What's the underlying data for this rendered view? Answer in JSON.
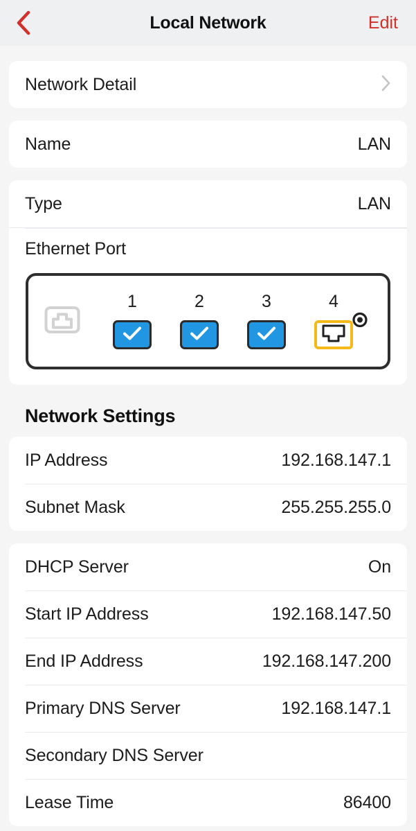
{
  "navbar": {
    "back_icon": "chevron-left-icon",
    "title": "Local Network",
    "edit_label": "Edit",
    "accent_color": "#d0312b"
  },
  "detail_card": {
    "label": "Network Detail",
    "disclosure_icon": "chevron-right-icon"
  },
  "name_card": {
    "label": "Name",
    "value": "LAN"
  },
  "type_card": {
    "type_label": "Type",
    "type_value": "LAN",
    "ethernet_label": "Ethernet Port"
  },
  "ethernet_panel": {
    "device_icon": "ethernet-port-icon",
    "indicator_icon": "led-indicator-icon",
    "ports": [
      {
        "number": "1",
        "state": "checked",
        "icon": "check-icon",
        "color": "#2196e3"
      },
      {
        "number": "2",
        "state": "checked",
        "icon": "check-icon",
        "color": "#2196e3"
      },
      {
        "number": "3",
        "state": "checked",
        "icon": "check-icon",
        "color": "#2196e3"
      },
      {
        "number": "4",
        "state": "wan",
        "icon": "rj45-jack-icon",
        "color": "#f5b919"
      }
    ]
  },
  "network_settings": {
    "title": "Network Settings",
    "rows": [
      {
        "label": "IP Address",
        "value": "192.168.147.1"
      },
      {
        "label": "Subnet Mask",
        "value": "255.255.255.0"
      }
    ]
  },
  "dhcp": {
    "rows": [
      {
        "label": "DHCP Server",
        "value": "On"
      },
      {
        "label": "Start IP Address",
        "value": "192.168.147.50"
      },
      {
        "label": "End IP Address",
        "value": "192.168.147.200"
      },
      {
        "label": "Primary DNS Server",
        "value": "192.168.147.1"
      },
      {
        "label": "Secondary DNS Server",
        "value": ""
      },
      {
        "label": "Lease Time",
        "value": "86400"
      }
    ]
  }
}
